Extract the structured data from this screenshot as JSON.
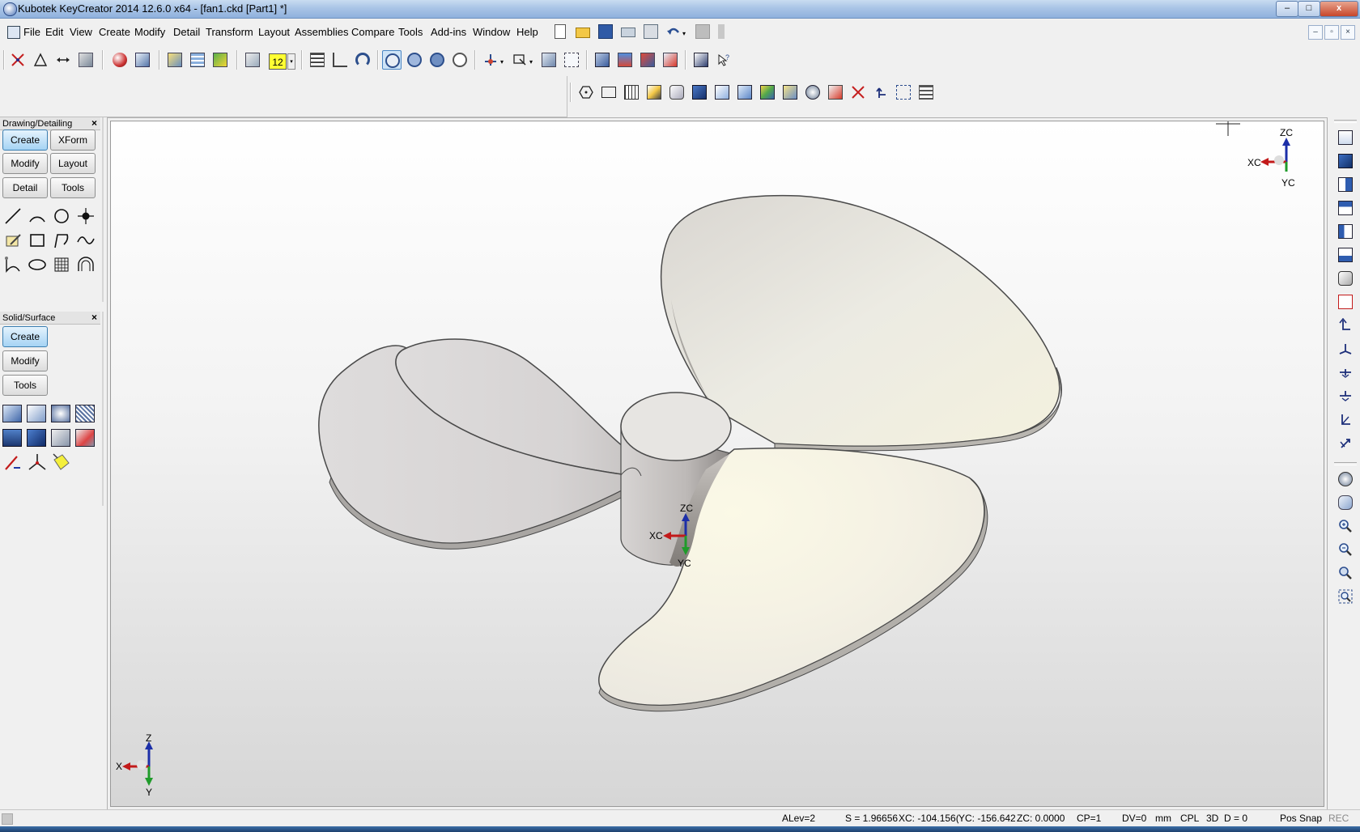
{
  "window": {
    "title": "Kubotek KeyCreator 2014 12.6.0 x64 - [fan1.ckd [Part1] *]",
    "minimize_glyph": "–",
    "maximize_glyph": "□",
    "close_glyph": "x"
  },
  "menu": {
    "items": [
      "File",
      "Edit",
      "View",
      "Create",
      "Modify",
      "Detail",
      "Transform",
      "Layout",
      "Assemblies",
      "Compare",
      "Tools",
      "Add-ins",
      "Window",
      "Help"
    ],
    "mdi_minimize_glyph": "–",
    "mdi_restore_glyph": "▫",
    "mdi_close_glyph": "×"
  },
  "toolbar": {
    "layer_number": "12",
    "dropdown_glyph": "▾"
  },
  "drawing_palette": {
    "title": "Drawing/Detailing",
    "close_glyph": "×",
    "buttons": [
      "Create",
      "XForm",
      "Modify",
      "Layout",
      "Detail",
      "Tools"
    ],
    "active": "Create"
  },
  "solid_palette": {
    "title": "Solid/Surface",
    "close_glyph": "×",
    "buttons": [
      "Create",
      "Modify",
      "Tools"
    ],
    "active": "Create"
  },
  "viewport": {
    "triad_top": {
      "z": "ZC",
      "x": "XC",
      "y": "YC"
    },
    "triad_model": {
      "z": "ZC",
      "x": "XC",
      "y": "YC"
    },
    "triad_world": {
      "z": "Z",
      "x": "X",
      "y": "Y"
    }
  },
  "status": {
    "alev": "ALev=2",
    "scale": "S = 1.96656",
    "xc": "XC: -104.156(",
    "yc": "YC: -156.642(",
    "zc": "ZC: 0.0000",
    "cp": "CP=1",
    "dv": "DV=0",
    "units": "mm",
    "cpl": "CPL",
    "mode": "3D",
    "depth": "D = 0",
    "snap": "Pos Snap",
    "rec": "REC"
  },
  "colors": {
    "accent_blue": "#3c7fb1",
    "axis_x": "#c21a1a",
    "axis_y": "#1f9b2a",
    "axis_z": "#1c2fa8"
  }
}
